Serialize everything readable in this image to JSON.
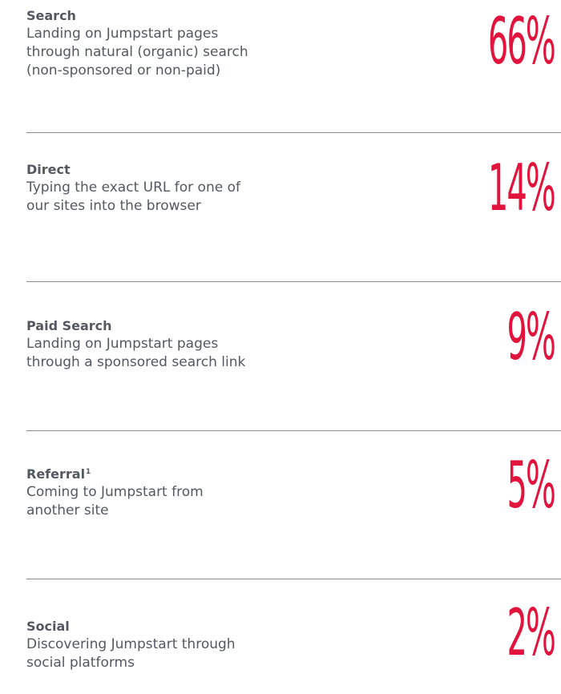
{
  "items": [
    {
      "label": "Search",
      "label_sup": "",
      "description_lines": [
        "Landing on Jumpstart pages",
        "through natural (organic) search",
        "(non-sponsored or non-paid)"
      ],
      "percent": "66%"
    },
    {
      "label": "Direct",
      "label_sup": "",
      "description_lines": [
        "Typing the exact URL for one of",
        "our sites into the browser"
      ],
      "percent": "14%"
    },
    {
      "label": "Paid Search",
      "label_sup": "",
      "description_lines": [
        "Landing on Jumpstart pages",
        "through a sponsored search link"
      ],
      "percent": "9%"
    },
    {
      "label": "Referral",
      "label_sup": "1",
      "description_lines": [
        "Coming to Jumpstart from",
        "another site"
      ],
      "percent": "5%"
    },
    {
      "label": "Social",
      "label_sup": "",
      "description_lines": [
        "Discovering Jumpstart through",
        "social platforms"
      ],
      "percent": "2%"
    }
  ],
  "colors": {
    "accent": "#e0143c",
    "text": "#545861",
    "divider": "#8a8d93"
  }
}
